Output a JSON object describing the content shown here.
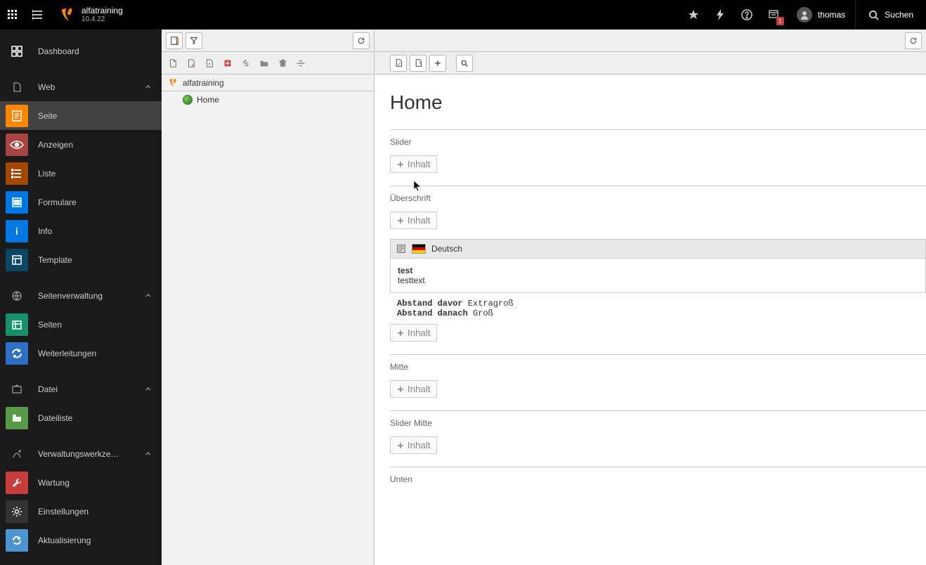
{
  "topbar": {
    "site_name": "alfatraining",
    "version": "10.4.22",
    "user": "thomas",
    "search": "Suchen",
    "notification_count": "1"
  },
  "modmenu": {
    "dashboard": "Dashboard",
    "groups": [
      {
        "label": "Web",
        "items": [
          {
            "label": "Seite",
            "icon": "ic-page",
            "active": true
          },
          {
            "label": "Anzeigen",
            "icon": "ic-view"
          },
          {
            "label": "Liste",
            "icon": "ic-list"
          },
          {
            "label": "Formulare",
            "icon": "ic-form"
          },
          {
            "label": "Info",
            "icon": "ic-info"
          },
          {
            "label": "Template",
            "icon": "ic-temp"
          }
        ]
      },
      {
        "label": "Seitenverwaltung",
        "items": [
          {
            "label": "Seiten",
            "icon": "ic-sites"
          },
          {
            "label": "Weiterleitungen",
            "icon": "ic-redir"
          }
        ]
      },
      {
        "label": "Datei",
        "items": [
          {
            "label": "Dateiliste",
            "icon": "ic-files"
          }
        ]
      },
      {
        "label": "Verwaltungswerkze…",
        "items": [
          {
            "label": "Wartung",
            "icon": "ic-maint"
          },
          {
            "label": "Einstellungen",
            "icon": "ic-settings"
          },
          {
            "label": "Aktualisierung",
            "icon": "ic-update"
          }
        ]
      }
    ]
  },
  "tree": {
    "root": "alfatraining",
    "pages": [
      "Home"
    ]
  },
  "page": {
    "title": "Home",
    "add_label": "Inhalt",
    "zones": [
      "Slider",
      "Überschrift",
      "Mitte",
      "Slider Mitte",
      "Unten"
    ],
    "ce": {
      "lang": "Deutsch",
      "title": "test",
      "text": "testtext",
      "spacing_before_label": "Abstand davor",
      "spacing_before_value": "Extragroß",
      "spacing_after_label": "Abstand danach",
      "spacing_after_value": "Groß"
    }
  }
}
